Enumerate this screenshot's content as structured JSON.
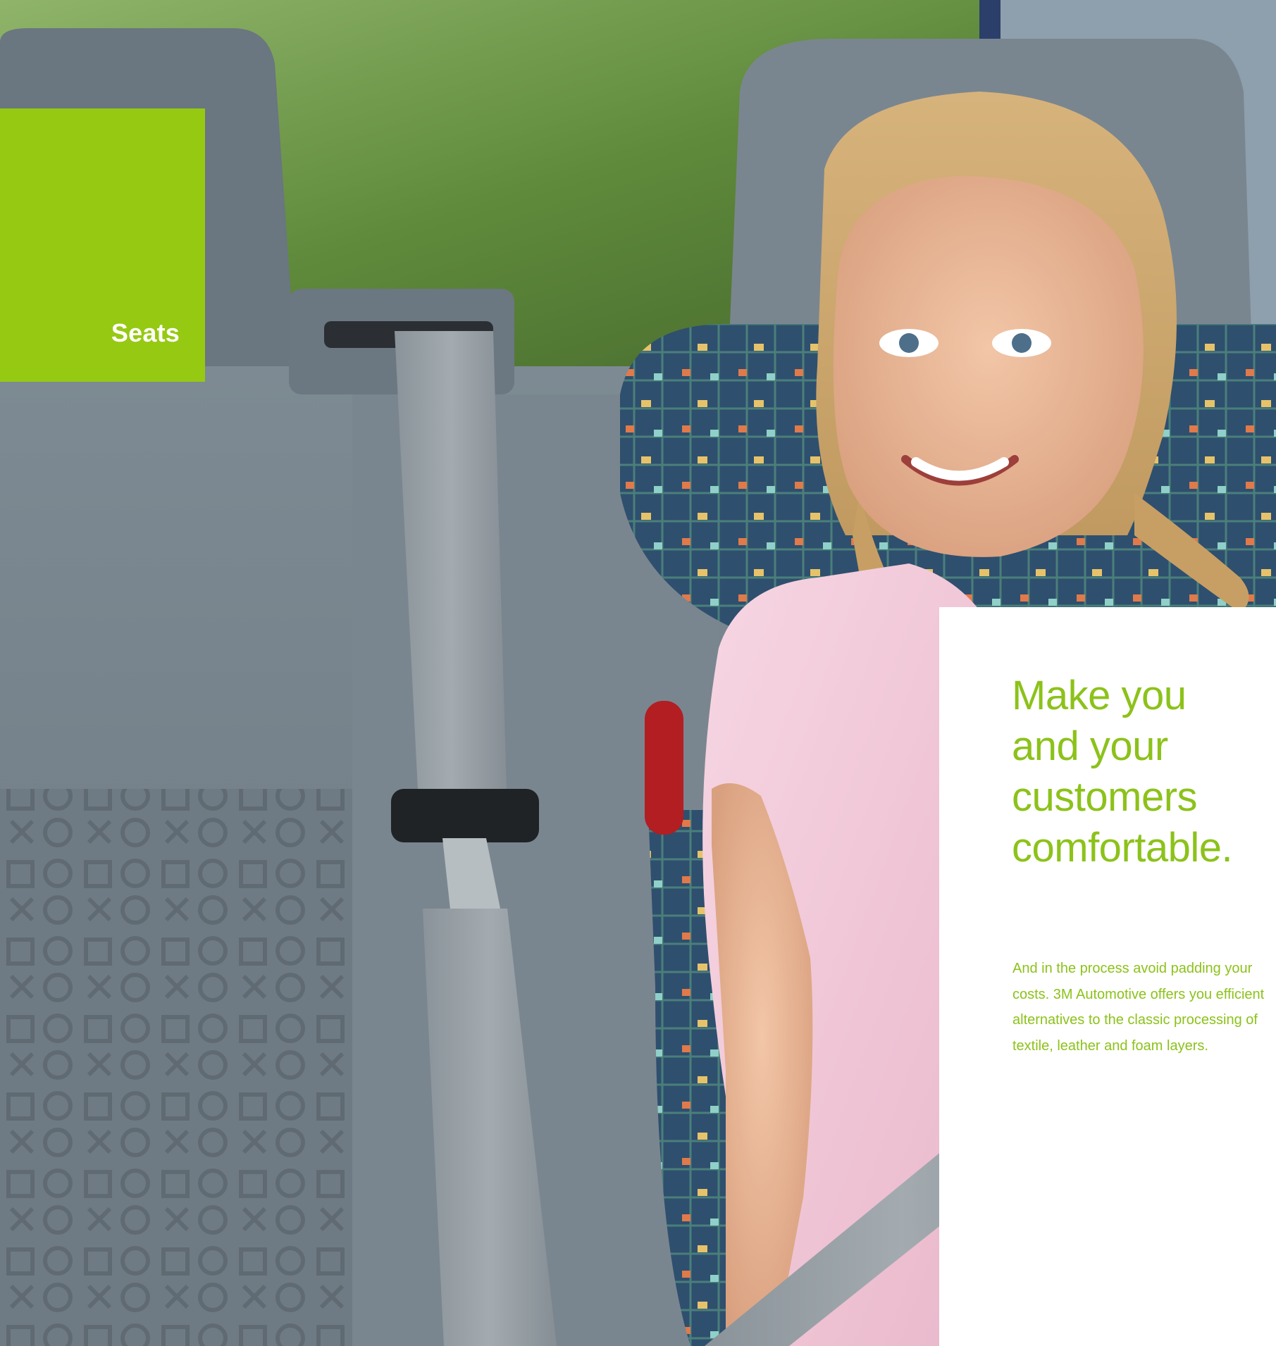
{
  "section": {
    "label": "Seats",
    "accent_color": "#96c912"
  },
  "copy": {
    "headline_lines": [
      "Make you",
      "and your",
      "customers",
      "comfortable."
    ],
    "body": "And in the process avoid padding your costs. 3M Automotive offers you efficient alternatives to the classic processing of textile, leather and foam layers.",
    "text_color": "#8cc21a"
  },
  "photo": {
    "subject": "girl-in-child-car-seat-photo"
  }
}
